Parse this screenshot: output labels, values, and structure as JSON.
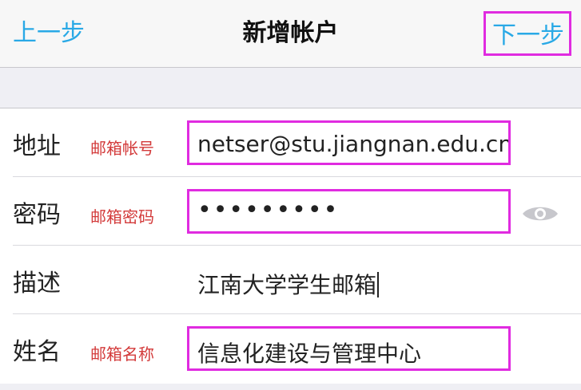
{
  "navbar": {
    "back_label": "上一步",
    "title": "新增帐户",
    "next_label": "下一步"
  },
  "form": {
    "address": {
      "label": "地址",
      "hint": "邮箱帐号",
      "value": "netser@stu.jiangnan.edu.cn"
    },
    "password": {
      "label": "密码",
      "hint": "邮箱密码",
      "value": "•••••••••",
      "reveal_icon": "eye-icon"
    },
    "description": {
      "label": "描述",
      "value": "江南大学学生邮箱"
    },
    "name": {
      "label": "姓名",
      "hint": "邮箱名称",
      "value": "信息化建设与管理中心"
    }
  },
  "colors": {
    "accent": "#29a9e6",
    "highlight_border": "#e02be0",
    "hint_text": "#d33a3a"
  }
}
